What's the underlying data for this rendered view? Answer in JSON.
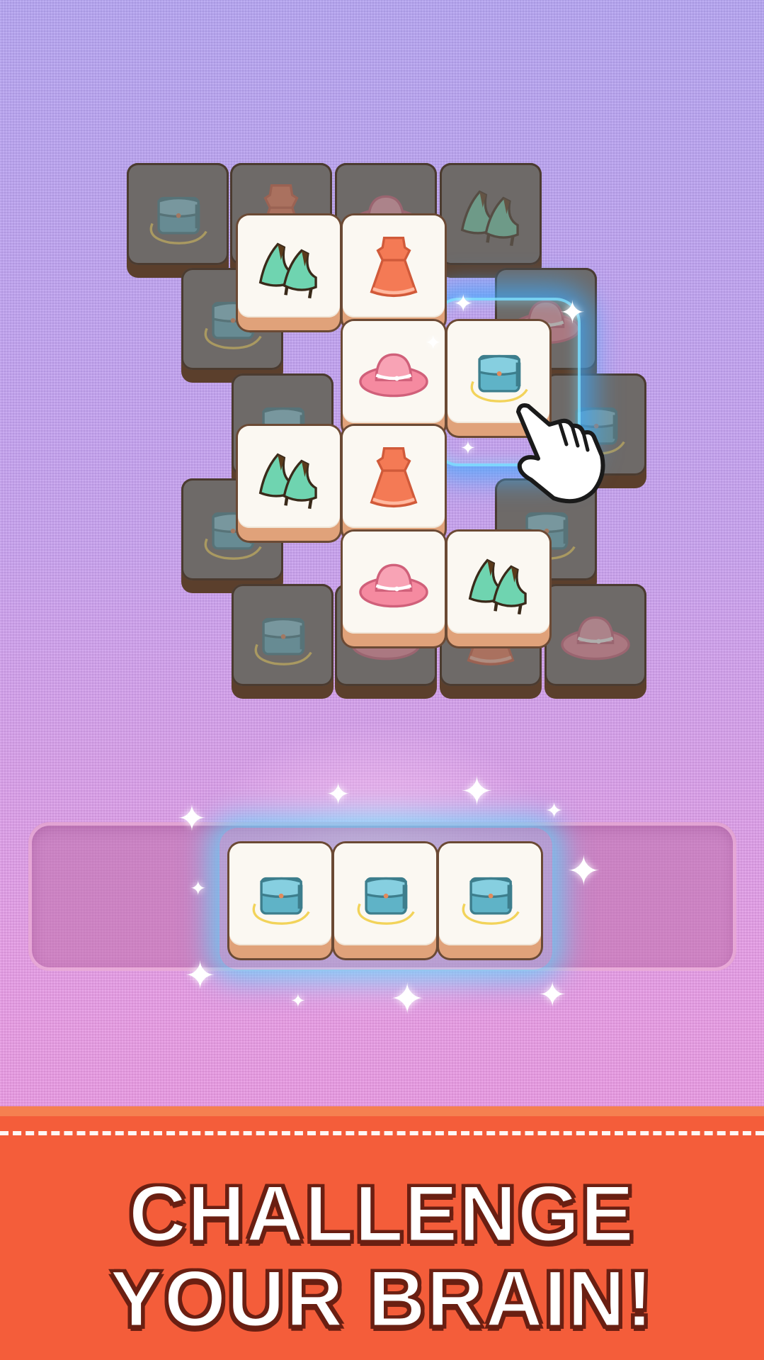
{
  "game": {
    "board_tiles": [
      {
        "icon": "purse-icon",
        "state": "covered"
      },
      {
        "icon": "dress-icon",
        "state": "covered"
      },
      {
        "icon": "hat-icon",
        "state": "covered"
      },
      {
        "icon": "heels-icon",
        "state": "covered"
      },
      {
        "icon": "heels-icon",
        "state": "open"
      },
      {
        "icon": "dress-icon",
        "state": "open"
      },
      {
        "icon": "hat-icon",
        "state": "open"
      },
      {
        "icon": "purse-icon",
        "state": "open-selected"
      },
      {
        "icon": "heels-icon",
        "state": "open"
      },
      {
        "icon": "dress-icon",
        "state": "open"
      },
      {
        "icon": "hat-icon",
        "state": "open"
      },
      {
        "icon": "heels-icon",
        "state": "open"
      }
    ],
    "tray_tiles": [
      "purse-icon",
      "purse-icon",
      "purse-icon"
    ],
    "tutorial_hand": "pointing-hand-icon"
  },
  "banner": {
    "line1": "CHALLENGE",
    "line2": "YOUR BRAIN!"
  },
  "colors": {
    "banner": "#f45d3a",
    "tile_face": "#fbf8f2",
    "tile_covered": "#6e6a68",
    "highlight": "#3caaff"
  }
}
